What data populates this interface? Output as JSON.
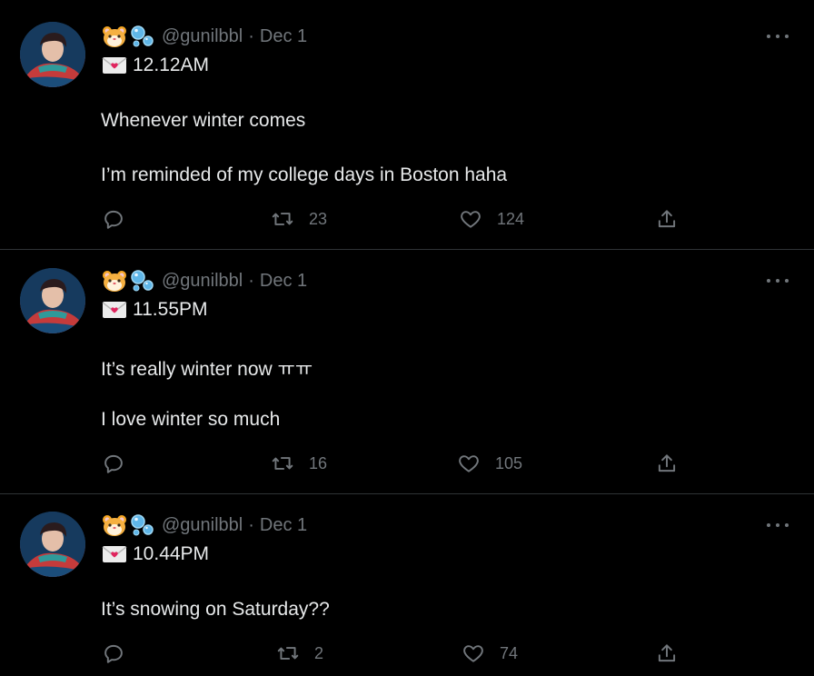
{
  "tweets": [
    {
      "handle": "@gunilbbl",
      "separator": "·",
      "date": "Dec 1",
      "time_label": "12.12AM",
      "lines": [
        "Whenever winter comes",
        "I’m reminded of my college days in Boston haha"
      ],
      "retweets": "23",
      "likes": "124"
    },
    {
      "handle": "@gunilbbl",
      "separator": "·",
      "date": "Dec 1",
      "time_label": "11.55PM",
      "lines": [
        "It’s really winter now ㅠㅠ",
        "I love winter so much"
      ],
      "retweets": "16",
      "likes": "105"
    },
    {
      "handle": "@gunilbbl",
      "separator": "·",
      "date": "Dec 1",
      "time_label": "10.44PM",
      "lines": [
        "It’s snowing on Saturday??"
      ],
      "retweets": "2",
      "likes": "74"
    }
  ],
  "icons": {
    "name_emoji_1": "hamster-face-icon",
    "name_emoji_2": "bubbles-icon",
    "time_emoji": "love-letter-icon",
    "more": "more-options-icon",
    "reply": "reply-icon",
    "retweet": "retweet-icon",
    "like": "heart-icon",
    "share": "share-icon"
  },
  "colors": {
    "background": "#000000",
    "text": "#e7e9ea",
    "secondary": "#71767b",
    "divider": "#2f3336"
  }
}
